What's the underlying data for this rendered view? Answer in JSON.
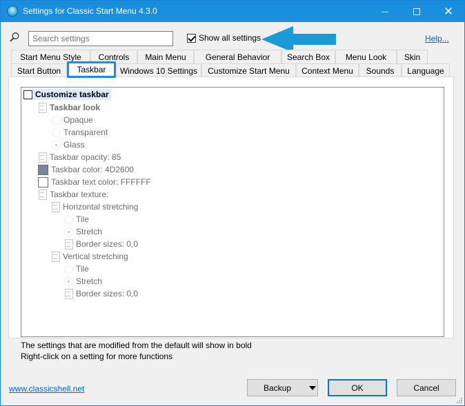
{
  "window": {
    "title": "Settings for Classic Start Menu 4.3.0",
    "minimize": "minimize",
    "maximize": "maximize",
    "close": "close"
  },
  "toolbar": {
    "search_placeholder": "Search settings",
    "show_all_label": "Show all settings",
    "show_all_checked": true,
    "help_label": "Help..."
  },
  "tabs_top": [
    "Start Menu Style",
    "Controls",
    "Main Menu",
    "General Behavior",
    "Search Box",
    "Menu Look",
    "Skin"
  ],
  "tabs_bottom": [
    "Start Button",
    "Taskbar",
    "Windows 10 Settings",
    "Customize Start Menu",
    "Context Menu",
    "Sounds",
    "Language"
  ],
  "active_tab": "Taskbar",
  "tree": {
    "root": "Customize taskbar",
    "items": [
      "Taskbar look",
      "Opaque",
      "Transparent",
      "Glass",
      "Taskbar opacity: 85",
      "Taskbar color: 4D2600",
      "Taskbar text color: FFFFFF",
      "Taskbar texture:",
      "Horizontal stretching",
      "Tile",
      "Stretch",
      "Border sizes: 0,0",
      "Vertical stretching",
      "Tile",
      "Stretch",
      "Border sizes: 0,0"
    ],
    "taskbar_color_hex": "#7b8794",
    "taskbar_text_color_hex": "#FFFFFF"
  },
  "hints": {
    "line1": "The settings that are modified from the default will show in bold",
    "line2": "Right-click on a setting for more functions"
  },
  "footer": {
    "site_link": "www.classicshell.net",
    "backup_label": "Backup",
    "ok_label": "OK",
    "cancel_label": "Cancel"
  },
  "colors": {
    "titlebar": "#1a8fe0",
    "accent": "#0078d7",
    "link": "#0066cc",
    "arrow": "#1a9ad6"
  }
}
